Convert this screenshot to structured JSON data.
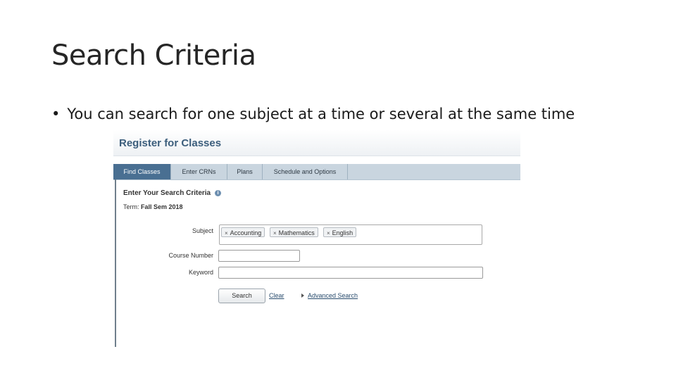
{
  "slide": {
    "title": "Search Criteria",
    "bullet_mark": "•",
    "bullet_text": "You can search for one subject at a time or several at the same time"
  },
  "app": {
    "header_title": "Register for Classes",
    "tabs": [
      {
        "label": "Find Classes",
        "active": true
      },
      {
        "label": "Enter CRNs",
        "active": false
      },
      {
        "label": "Plans",
        "active": false
      },
      {
        "label": "Schedule and Options",
        "active": false
      }
    ],
    "criteria_title": "Enter Your Search Criteria",
    "info_icon": "i",
    "term_label": "Term:",
    "term_value": "Fall Sem 2018",
    "subject_label": "Subject",
    "subject_chips": [
      {
        "remove_glyph": "×",
        "label": "Accounting"
      },
      {
        "remove_glyph": "×",
        "label": "Mathematics"
      },
      {
        "remove_glyph": "×",
        "label": "English"
      }
    ],
    "course_number_label": "Course Number",
    "course_number_value": "",
    "keyword_label": "Keyword",
    "keyword_value": "",
    "search_button": "Search",
    "clear_link": "Clear",
    "advanced_search_link": "Advanced Search"
  },
  "colors": {
    "active_tab": "#496f92",
    "tab_bar": "#c9d5df",
    "header_text": "#3c5e7c",
    "link": "#2a4d6e"
  },
  "icons": {
    "chip_remove": "close-icon",
    "info": "info-icon",
    "advanced_toggle": "triangle-right-icon"
  }
}
